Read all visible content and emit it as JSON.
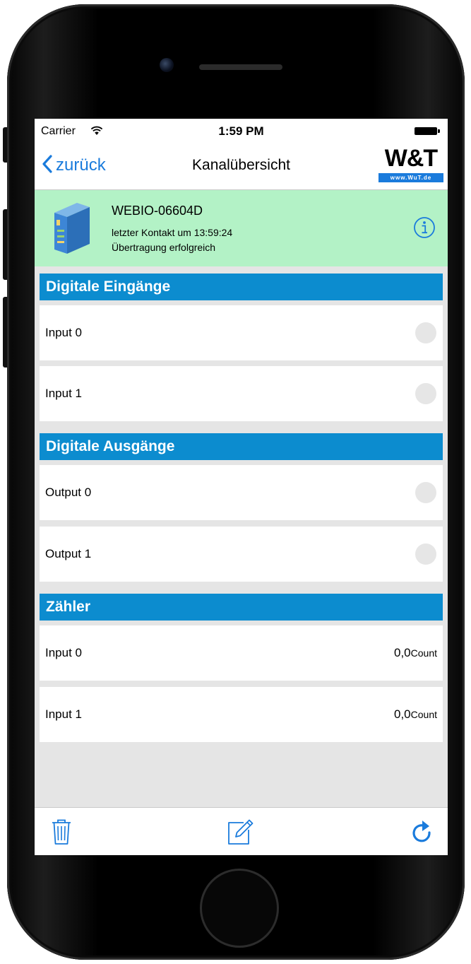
{
  "status_bar": {
    "carrier": "Carrier",
    "time": "1:59 PM"
  },
  "nav": {
    "back_label": "zurück",
    "title": "Kanalübersicht",
    "logo_text": "W&T",
    "logo_sub": "www.WuT.de"
  },
  "device": {
    "name": "WEBIO-06604D",
    "last_contact": "letzter Kontakt um 13:59:24",
    "status": "Übertragung erfolgreich"
  },
  "sections": {
    "digital_inputs": {
      "title": "Digitale Eingänge",
      "items": [
        {
          "label": "Input 0"
        },
        {
          "label": "Input 1"
        }
      ]
    },
    "digital_outputs": {
      "title": "Digitale Ausgänge",
      "items": [
        {
          "label": "Output 0"
        },
        {
          "label": "Output 1"
        }
      ]
    },
    "counters": {
      "title": "Zähler",
      "items": [
        {
          "label": "Input 0",
          "value": "0,0",
          "unit": "Count"
        },
        {
          "label": "Input 1",
          "value": "0,0",
          "unit": "Count"
        }
      ]
    }
  },
  "colors": {
    "accent": "#1a7bdc",
    "section_header": "#0c8ccf",
    "device_panel": "#b3f2c6",
    "led_off": "#e6e6e6"
  },
  "icons": {
    "back": "chevron-left-icon",
    "info": "info-icon",
    "delete": "trash-icon",
    "edit": "edit-icon",
    "refresh": "refresh-icon",
    "wifi": "wifi-icon",
    "battery": "battery-icon",
    "device": "device-box-icon"
  }
}
